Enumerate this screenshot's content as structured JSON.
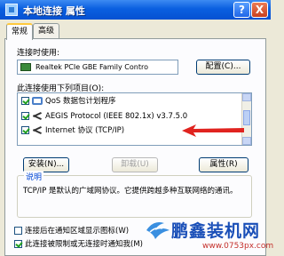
{
  "window": {
    "title": "本地连接 属性",
    "help_label": "?",
    "close_label": "X"
  },
  "tabs": [
    {
      "label": "常规",
      "active": true
    },
    {
      "label": "高级",
      "active": false
    }
  ],
  "general": {
    "connect_using_label": "连接时使用:",
    "adapter_name": "Realtek PCIe GBE Family Contro",
    "configure_button": "配置(C)...",
    "items_label": "此连接使用下列项目(O):",
    "items": [
      {
        "label": "QoS 数据包计划程序",
        "checked": true,
        "icon": "qos-icon"
      },
      {
        "label": "AEGIS Protocol (IEEE 802.1x) v3.7.5.0",
        "checked": true,
        "icon": "protocol-icon"
      },
      {
        "label": "Internet 协议 (TCP/IP)",
        "checked": true,
        "icon": "protocol-icon"
      }
    ],
    "install_button": "安装(N)...",
    "uninstall_button": "卸载(U)",
    "properties_button": "属性(R)",
    "description_title": "说明",
    "description_text": "TCP/IP 是默认的广域网协议。它提供跨越多种互联网络的通讯。",
    "show_icon_option": "连接后在通知区域显示图标(W)",
    "notify_option": "此连接被限制或无连接时通知我(M)"
  },
  "watermark": {
    "title": "鹏鑫装机网",
    "url": "www.0753px.com"
  },
  "colors": {
    "title_bar": "#0a5fe0",
    "dialog_bg": "#ece9d8",
    "panel_bg": "#fcfcfe",
    "arrow": "#e0231f",
    "watermark_title": "#1a4fb8",
    "watermark_url": "#c4302b"
  }
}
